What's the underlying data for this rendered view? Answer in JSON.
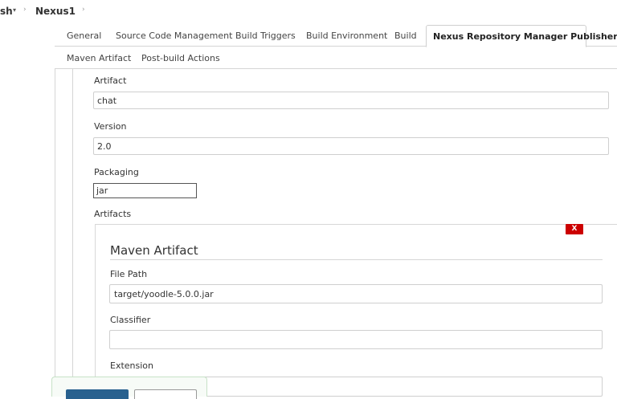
{
  "breadcrumb": {
    "item0": "sh",
    "item1": "Nexus1",
    "caret": "▾",
    "arrow": "›"
  },
  "tabs": {
    "row1": [
      "General",
      "Source Code Management",
      "Build Triggers",
      "Build Environment",
      "Build",
      "Nexus Repository Manager Publisher"
    ],
    "row2": [
      "Maven Artifact",
      "Post-build Actions"
    ],
    "active": "Nexus Repository Manager Publisher"
  },
  "form": {
    "artifact_label": "Artifact",
    "artifact_value": "chat",
    "version_label": "Version",
    "version_value": "2.0",
    "packaging_label": "Packaging",
    "packaging_value": "jar",
    "artifacts_label": "Artifacts"
  },
  "maven_artifact": {
    "title": "Maven Artifact",
    "delete_label": "X",
    "file_path_label": "File Path",
    "file_path_value": "target/yoodle-5.0.0.jar",
    "classifier_label": "Classifier",
    "classifier_value": "",
    "extension_label": "Extension",
    "extension_value": ""
  },
  "colors": {
    "delete": "#cc0000",
    "primary": "#29618f"
  }
}
